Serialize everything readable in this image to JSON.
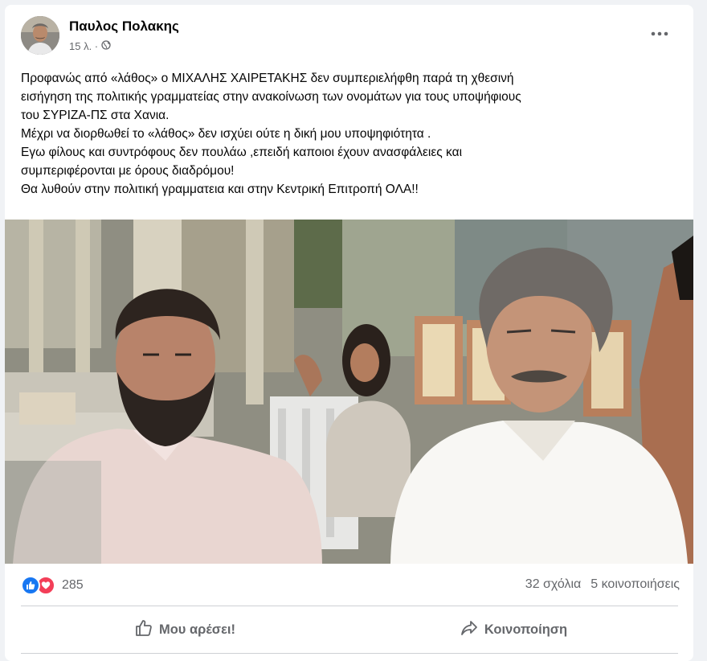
{
  "post": {
    "author": "Παυλος Πολακης",
    "timestamp": "15 λ. ·",
    "privacy_icon": "globe-icon",
    "menu_icon": "more-options-icon",
    "body_lines": [
      "Προφανώς από «λάθος»  ο ΜΙΧΑΛΗΣ ΧΑΙΡΕΤΑΚΗΣ δεν συμπεριελήφθη παρά τη χθεσινή",
      "εισήγηση της πολιτικής γραμματείας στην ανακοίνωση των ονομάτων για τους υποψήφιους",
      "του ΣΥΡΙΖΑ-ΠΣ στα Χανια.",
      "Μέχρι να διορθωθεί το «λάθος» δεν ισχύει ούτε η δική  μου υποψηφιότητα .",
      "Εγω φίλους και συντρόφους δεν πουλάω ,επειδή καποιοι έχουν ανασφάλειες και",
      "συμπεριφέρονται με όρους διαδρόμου!",
      "Θα λυθούν στην πολιτική γραμματεια  και στην Κεντρική Επιτροπή  ΟΛΑ!!"
    ]
  },
  "stats": {
    "reaction_icons": [
      "like-icon",
      "love-icon"
    ],
    "reaction_count": "285",
    "comments": "32 σχόλια",
    "shares": "5 κοινοποιήσεις"
  },
  "actions": {
    "like_label": "Μου αρέσει!",
    "like_icon": "thumbs-up-icon",
    "share_label": "Κοινοποίηση",
    "share_icon": "share-arrow-icon"
  },
  "colors": {
    "link_blue": "#1877f2",
    "love_red": "#f33e58",
    "secondary_text": "#65676b",
    "background": "#f0f2f5"
  }
}
